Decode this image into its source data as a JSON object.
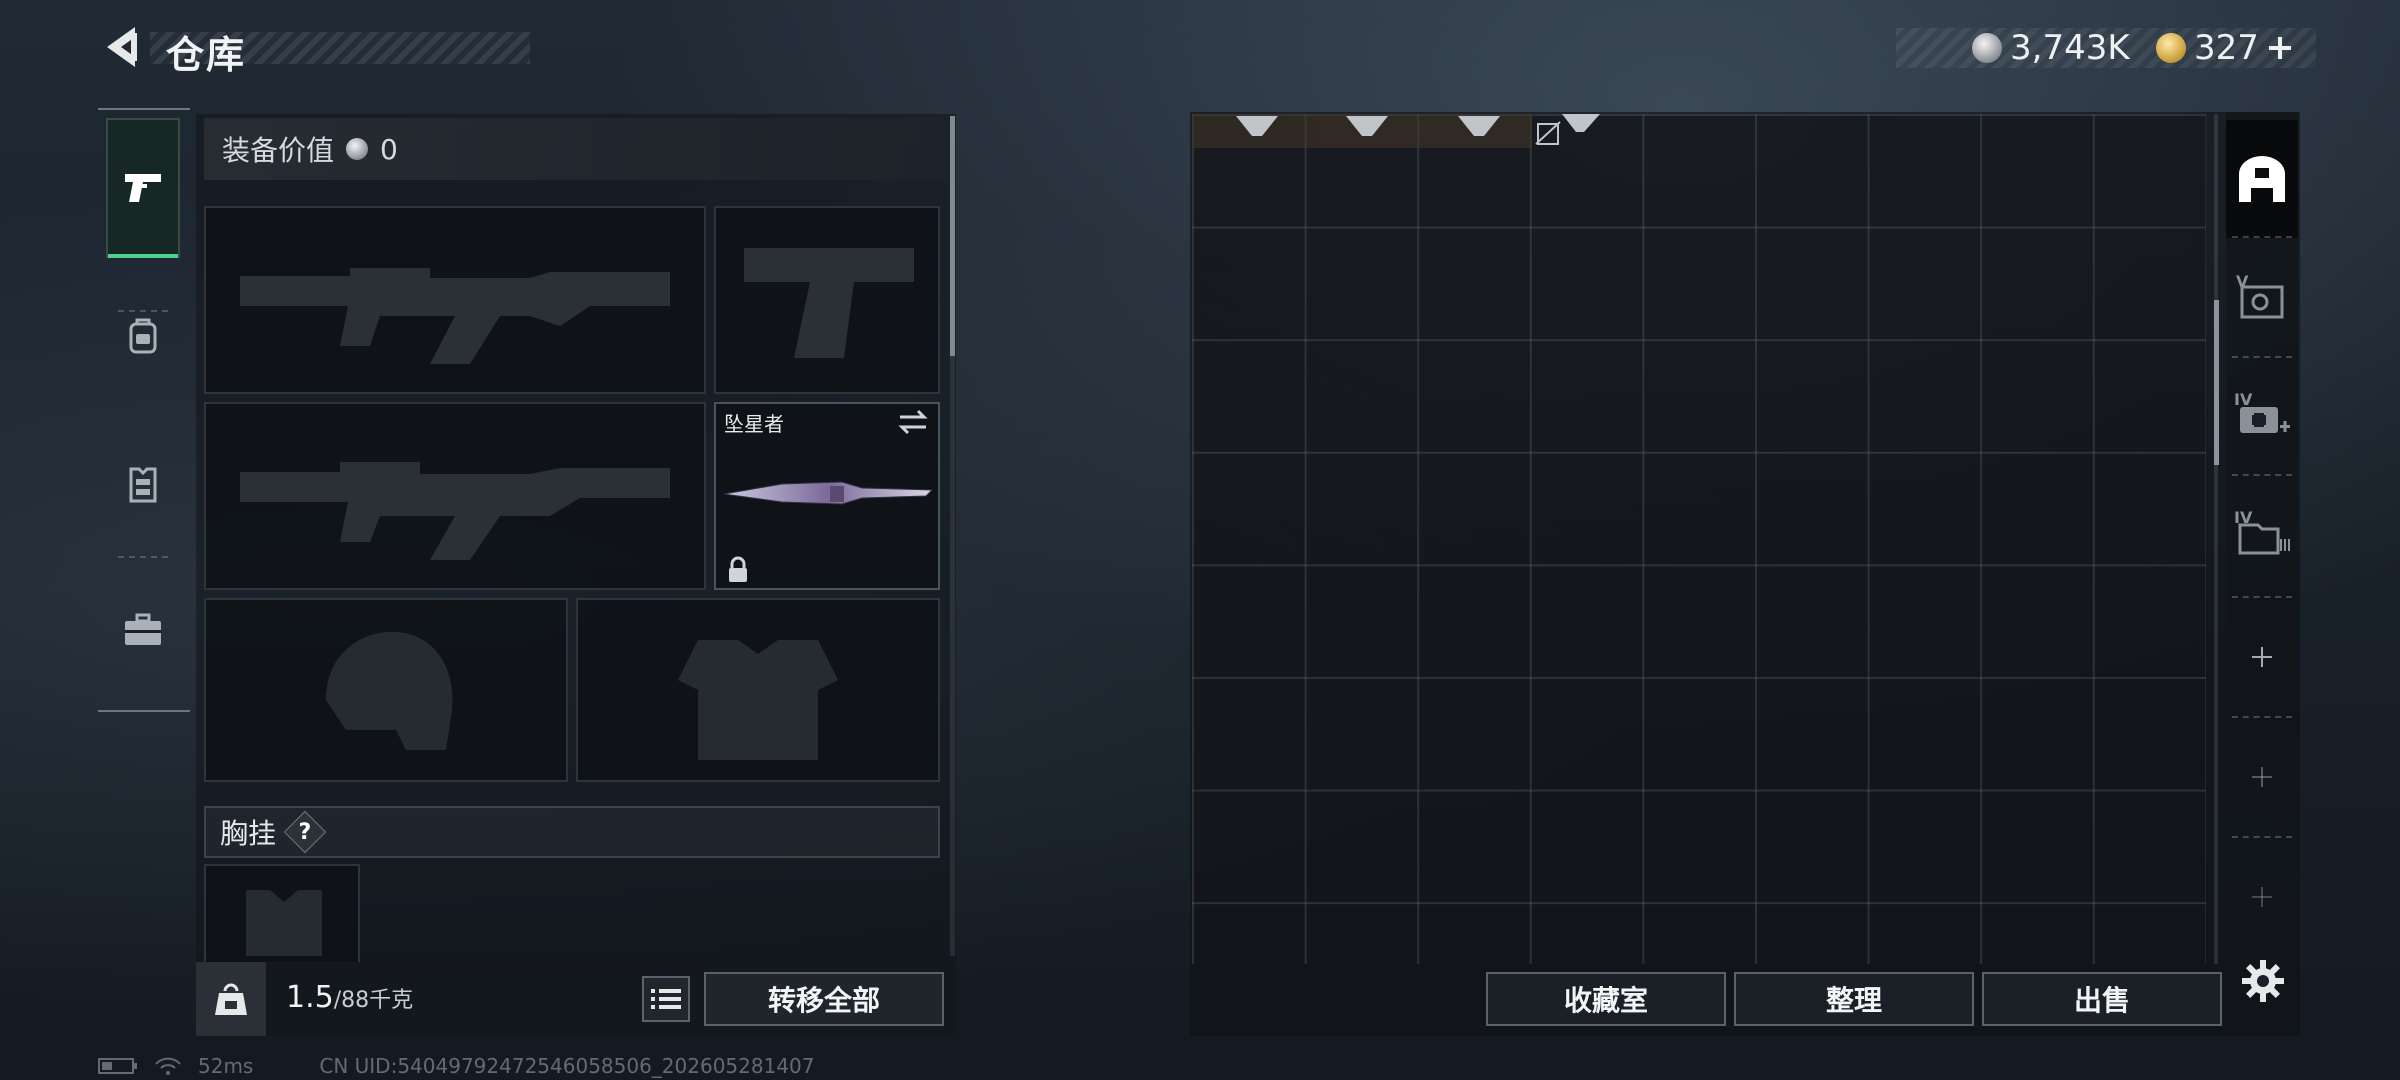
{
  "header": {
    "title": "仓库",
    "back_icon": "back-arrow-icon"
  },
  "currencies": [
    {
      "icon": "silver-coin-icon",
      "value": "3,743K"
    },
    {
      "icon": "gold-coin-icon",
      "value": "327",
      "add_icon": "plus-icon"
    }
  ],
  "left_rail": {
    "tabs": [
      {
        "icon": "pistol-icon",
        "active": true
      },
      {
        "icon": "backpack-icon",
        "active": false
      },
      {
        "icon": "vest-icon",
        "active": false
      },
      {
        "icon": "briefcase-icon",
        "active": false
      }
    ]
  },
  "equipment": {
    "value_label": "装备价值",
    "value": "0",
    "slots": [
      {
        "type": "primary-weapon",
        "icon": "rifle-silhouette-icon",
        "empty": true
      },
      {
        "type": "sidearm",
        "icon": "pistol-silhouette-icon",
        "empty": true
      },
      {
        "type": "secondary-weapon",
        "icon": "rifle-silhouette-icon",
        "empty": true
      },
      {
        "type": "melee",
        "name": "坠星者",
        "icon": "knife-icon",
        "locked": true
      },
      {
        "type": "helmet",
        "icon": "helmet-silhouette-icon",
        "empty": true
      },
      {
        "type": "armor",
        "icon": "armor-silhouette-icon",
        "empty": true
      }
    ],
    "chest_rig_label": "胸挂",
    "chest_rig_help": "?"
  },
  "footer": {
    "weight_current": "1.5",
    "weight_max": "/88千克",
    "transfer_all": "转移全部"
  },
  "status": {
    "ping": "52ms",
    "uid": "CN UID:540497924725460585​06_202605281407"
  },
  "storage": {
    "side_items": [
      {
        "icon": "storage-home-icon",
        "active": true
      },
      {
        "icon": "safe-box-level-v-icon",
        "active": false
      },
      {
        "icon": "medical-box-level-iv-icon",
        "active": false
      },
      {
        "icon": "ammo-box-level-iv-icon",
        "active": false
      },
      {
        "icon": "add-icon",
        "active": false
      },
      {
        "icon": "add-icon",
        "active": false
      },
      {
        "icon": "add-icon",
        "active": false
      }
    ],
    "buttons": {
      "collection": "收藏室",
      "organize": "整理",
      "sell": "出售"
    }
  },
  "colors": {
    "accent_green": "#4fcf8d",
    "panel_bg": "#161b20",
    "border": "#5a636b"
  }
}
